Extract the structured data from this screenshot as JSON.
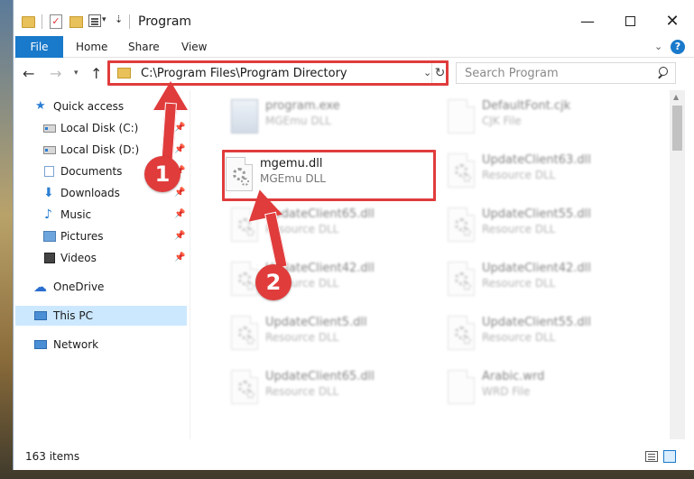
{
  "window": {
    "title": "Program",
    "controls": {
      "minimize": "—",
      "close": "✕"
    }
  },
  "ribbon": {
    "tabs": [
      "File",
      "Home",
      "Share",
      "View"
    ],
    "help": "?"
  },
  "address": {
    "path": "C:\\Program Files\\Program Directory",
    "search_placeholder": "Search Program"
  },
  "nav_pane": {
    "items": [
      {
        "label": "Quick access",
        "icon": "star-icon",
        "pinned": false
      },
      {
        "label": "Local Disk (C:)",
        "icon": "drive-icon",
        "pinned": true
      },
      {
        "label": "Local Disk (D:)",
        "icon": "drive-icon",
        "pinned": true
      },
      {
        "label": "Documents",
        "icon": "documents-icon",
        "pinned": true
      },
      {
        "label": "Downloads",
        "icon": "downloads-icon",
        "pinned": true
      },
      {
        "label": "Music",
        "icon": "music-icon",
        "pinned": true
      },
      {
        "label": "Pictures",
        "icon": "pictures-icon",
        "pinned": true
      },
      {
        "label": "Videos",
        "icon": "videos-icon",
        "pinned": true
      },
      {
        "label": "OneDrive",
        "icon": "cloud-icon",
        "pinned": false
      },
      {
        "label": "This PC",
        "icon": "computer-icon",
        "pinned": false,
        "selected": true
      },
      {
        "label": "Network",
        "icon": "network-icon",
        "pinned": false
      }
    ]
  },
  "files": [
    {
      "name": "program.exe",
      "type": "MGEmu DLL",
      "blurred": true
    },
    {
      "name": "DefaultFont.cjk",
      "type": "CJK File",
      "blurred": true
    },
    {
      "name": "mgemu.dll",
      "type": "MGEmu DLL",
      "blurred": false,
      "highlighted": true
    },
    {
      "name": "UpdateClient63.dll",
      "type": "Resource DLL",
      "blurred": true
    },
    {
      "name": "UpdateClient65.dll",
      "type": "Resource DLL",
      "blurred": true
    },
    {
      "name": "UpdateClient55.dll",
      "type": "Resource DLL",
      "blurred": true
    },
    {
      "name": "UpdateClient42.dll",
      "type": "Resource DLL",
      "blurred": true
    },
    {
      "name": "UpdateClient42.dll",
      "type": "Resource DLL",
      "blurred": true
    },
    {
      "name": "UpdateClient5.dll",
      "type": "Resource DLL",
      "blurred": true
    },
    {
      "name": "UpdateClient55.dll",
      "type": "Resource DLL",
      "blurred": true
    },
    {
      "name": "UpdateClient65.dll",
      "type": "Resource DLL",
      "blurred": true
    },
    {
      "name": "Arabic.wrd",
      "type": "WRD File",
      "blurred": true
    }
  ],
  "annotations": {
    "step1": "1",
    "step2": "2",
    "color": "#e03c3c"
  },
  "status": {
    "item_count": "163 items"
  },
  "colors": {
    "accent": "#1979ca",
    "selection": "#cce8ff",
    "annotation": "#e03c3c"
  }
}
